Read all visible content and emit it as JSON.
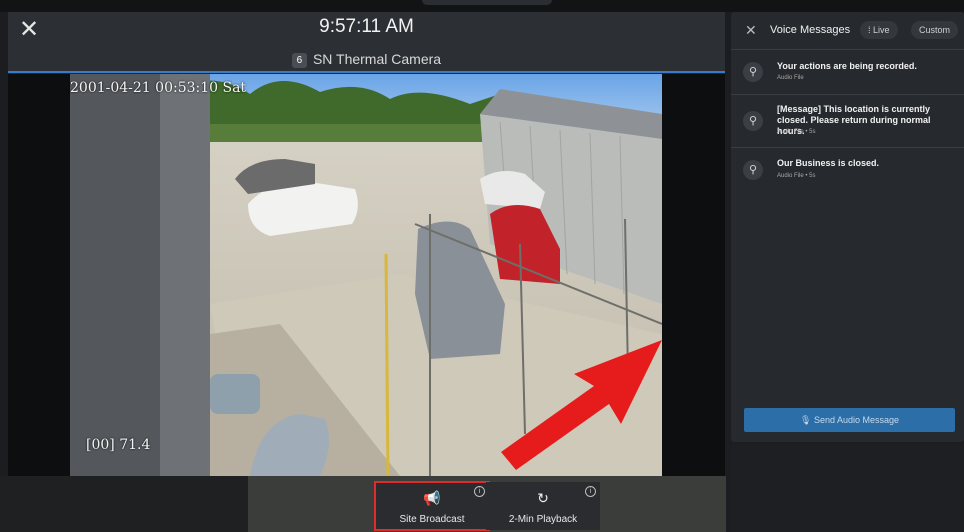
{
  "camera": {
    "time": "9:57:11 AM",
    "number": "6",
    "name": "SN Thermal Camera",
    "osd_datetime": "2001-04-21 00:53:10 Sat",
    "osd_channel": "[00] 71.4"
  },
  "icons": {
    "close": "close-icon",
    "broadcast": "megaphone-icon",
    "playback": "replay-icon",
    "info": "info-icon",
    "clip": "paperclip-icon",
    "mic": "microphone-icon",
    "live": "waveform-icon"
  },
  "actions": {
    "broadcast_label": "Site Broadcast",
    "playback_label": "2-Min Playback"
  },
  "voice_messages": {
    "title": "Voice Messages",
    "tabs": {
      "live": "Live",
      "custom": "Custom"
    },
    "items": [
      {
        "text": "Your actions are being recorded.",
        "meta": "Audio File"
      },
      {
        "text": "[Message] This location is currently closed. Please return during normal hours.",
        "meta": "Audio File • 5s"
      },
      {
        "text": "Our Business is closed.",
        "meta": "Audio File • 5s"
      }
    ],
    "send_label": "Send Audio Message"
  },
  "colors": {
    "accent": "#2c6ea8",
    "highlight": "#e02b2b",
    "panel": "#26292d"
  }
}
